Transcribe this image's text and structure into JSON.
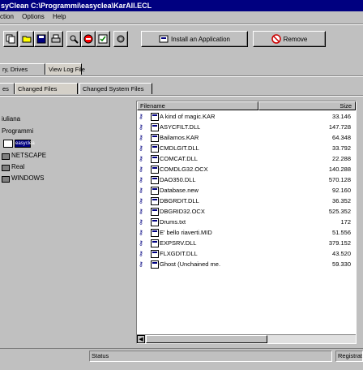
{
  "window": {
    "title": "syClean C:\\Programmi\\easyclea\\KarAll.ECL"
  },
  "menu": [
    "ction",
    "Options",
    "Help"
  ],
  "toolbar": {
    "install_label": "Install an Application",
    "remove_label": "Remove"
  },
  "tabs_top": [
    "ry, Drives",
    "View Log File"
  ],
  "tabs_bottom": [
    "es",
    "Changed Files",
    "Changed System Files"
  ],
  "tree": {
    "items": [
      "iuliana",
      "Programmi",
      "easyclea",
      "NETSCAPE",
      "Real",
      "WINDOWS"
    ]
  },
  "list": {
    "headers": {
      "filename": "Filename",
      "size": "Size"
    },
    "rows": [
      {
        "name": "A kind of magic.KAR",
        "size": "33.146"
      },
      {
        "name": "ASYCFILT.DLL",
        "size": "147.728"
      },
      {
        "name": "Bailamos.KAR",
        "size": "64.348"
      },
      {
        "name": "CMDLGIT.DLL",
        "size": "33.792"
      },
      {
        "name": "COMCAT.DLL",
        "size": "22.288"
      },
      {
        "name": "COMDLG32.OCX",
        "size": "140.288"
      },
      {
        "name": "DAO350.DLL",
        "size": "570.128"
      },
      {
        "name": "Database.new",
        "size": "92.160"
      },
      {
        "name": "DBGRDIT.DLL",
        "size": "36.352"
      },
      {
        "name": "DBGRID32.OCX",
        "size": "525.352"
      },
      {
        "name": "Drums.txt",
        "size": "172"
      },
      {
        "name": "E' bello riaverti.MID",
        "size": "51.556"
      },
      {
        "name": "EXPSRV.DLL",
        "size": "379.152"
      },
      {
        "name": "FLXGDIT.DLL",
        "size": "43.520"
      },
      {
        "name": "Ghost (Unchained me.",
        "size": "59.330"
      }
    ]
  },
  "status": {
    "left": "Status",
    "right": "Registrat"
  }
}
